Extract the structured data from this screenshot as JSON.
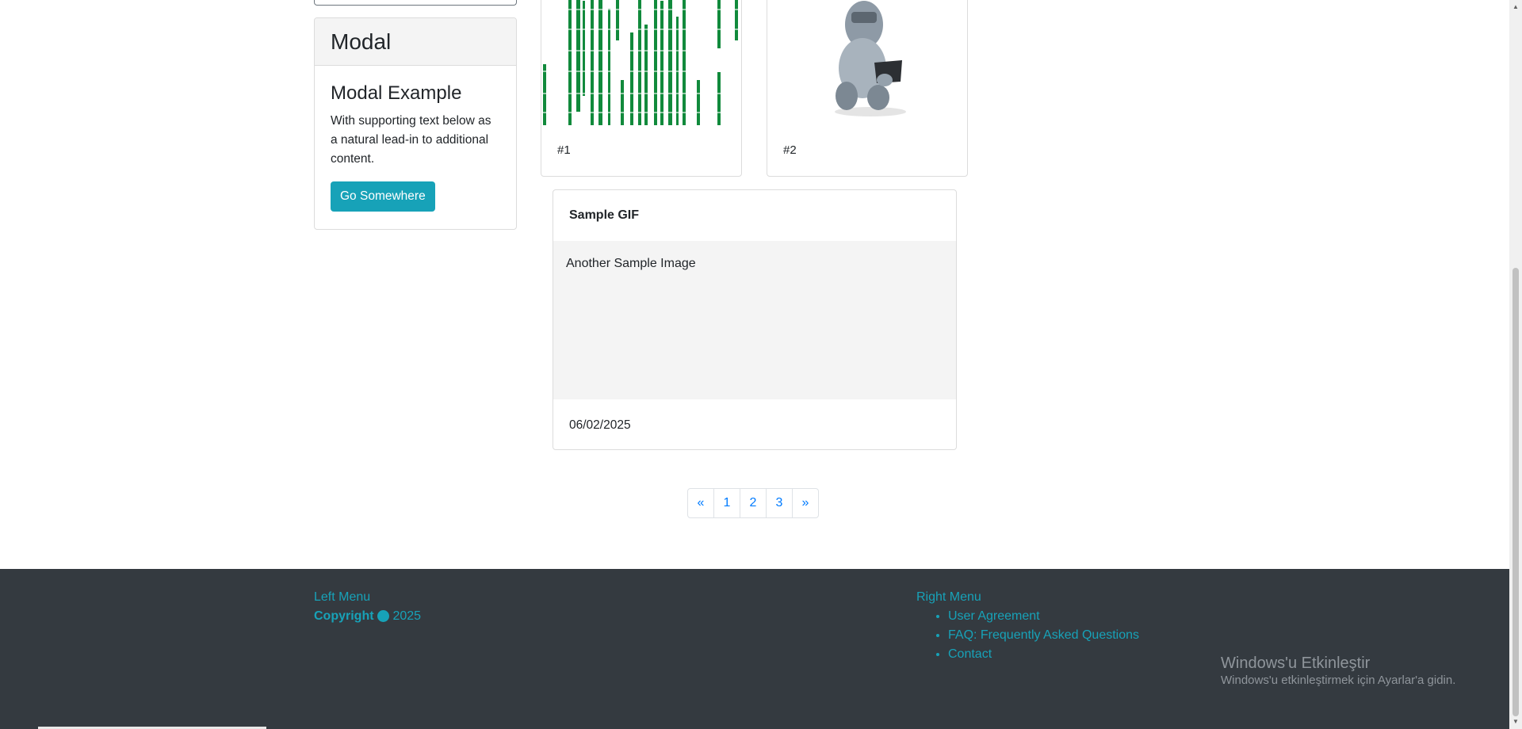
{
  "sidebar": {
    "modal_card": {
      "header": "Modal",
      "title": "Modal Example",
      "text": "With supporting text below as a natural lead-in to additional content.",
      "button_label": "Go Somewhere"
    }
  },
  "gallery": {
    "cards": [
      {
        "caption": "#1",
        "image": "matrix-code-image"
      },
      {
        "caption": "#2",
        "image": "robot-with-laptop-image"
      }
    ],
    "gif_card": {
      "title": "Sample GIF",
      "image_alt": "Another Sample Image",
      "date": "06/02/2025"
    }
  },
  "pagination": {
    "prev": "«",
    "pages": [
      "1",
      "2",
      "3"
    ],
    "next": "»"
  },
  "footer": {
    "left_menu_label": "Left Menu",
    "copyright_label": "Copyright",
    "copyright_symbol": "C",
    "copyright_year": "2025",
    "right_menu_label": "Right Menu",
    "links": [
      "User Agreement",
      "FAQ: Frequently Asked Questions",
      "Contact"
    ]
  },
  "activation": {
    "title": "Windows'u Etkinleştir",
    "subtitle": "Windows'u etkinleştirmek için Ayarlar'a gidin."
  },
  "colors": {
    "accent": "#17a2b8",
    "footer_bg": "#343a40",
    "link": "#007bff"
  }
}
